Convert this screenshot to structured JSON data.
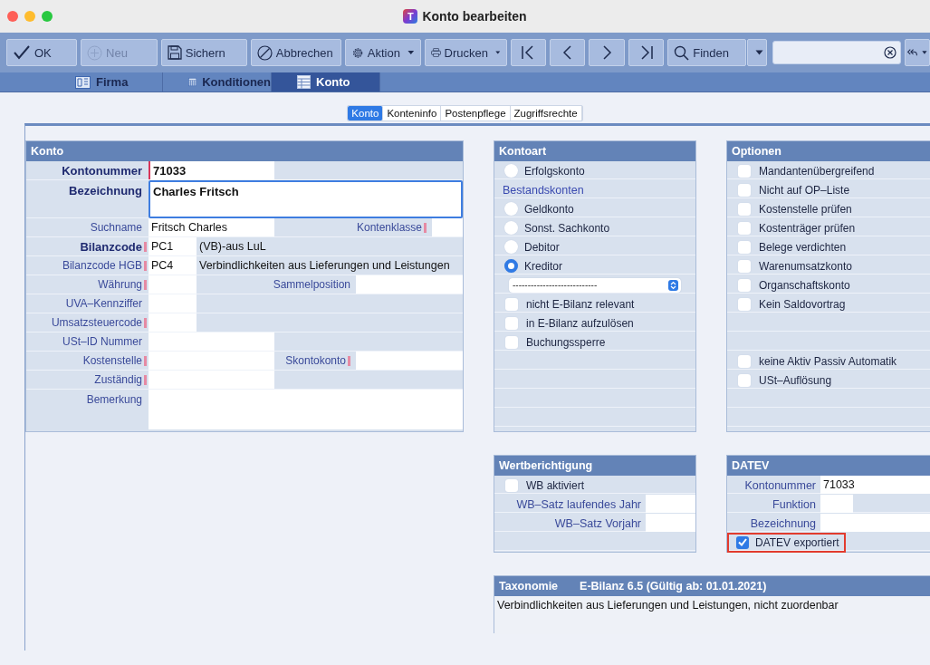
{
  "window": {
    "title": "Konto bearbeiten",
    "logo_text": "T"
  },
  "toolbar": {
    "buttons": [
      {
        "kind": "ok",
        "label": "OK",
        "disabled": false,
        "dropdown": false
      },
      {
        "kind": "new",
        "label": "Neu",
        "disabled": true,
        "dropdown": false
      },
      {
        "kind": "save",
        "label": "Sichern",
        "disabled": false,
        "dropdown": false
      },
      {
        "kind": "cancel",
        "label": "Abbrechen",
        "disabled": false,
        "dropdown": false
      },
      {
        "kind": "action",
        "label": "Aktion",
        "disabled": false,
        "dropdown": true
      },
      {
        "kind": "print",
        "label": "Drucken",
        "disabled": false,
        "dropdown": true
      },
      {
        "kind": "first",
        "disabled": false,
        "dropdown": false
      },
      {
        "kind": "previous",
        "disabled": false,
        "dropdown": false
      },
      {
        "kind": "next",
        "disabled": false,
        "dropdown": false
      },
      {
        "kind": "last",
        "disabled": false,
        "dropdown": false
      },
      {
        "kind": "find",
        "label": "Finden",
        "disabled": false,
        "dropdown": true
      }
    ]
  },
  "tabs": [
    {
      "label": "Firma",
      "selected": false
    },
    {
      "label": "Konditionen",
      "selected": false
    },
    {
      "label": "Konto",
      "selected": true
    }
  ],
  "subtabs": [
    {
      "label": "Konto",
      "selected": true
    },
    {
      "label": "Konteninfo",
      "selected": false
    },
    {
      "label": "Postenpflege",
      "selected": false
    },
    {
      "label": "Zugriffsrechte",
      "selected": false
    }
  ],
  "konto_panel": {
    "title": "Konto",
    "rows": [
      {
        "kind": "number",
        "label": "Kontonummer",
        "bold": true,
        "marked": false,
        "value": "71033"
      },
      {
        "kind": "name",
        "label": "Bezeichnung",
        "bold": true,
        "marked": false,
        "value": "Charles Fritsch"
      },
      {
        "kind": "pair-narrow",
        "label": "Suchname",
        "bold": false,
        "marked": false,
        "value": "Fritsch Charles",
        "label_2": "Kontenklasse",
        "marked_2": true
      },
      {
        "kind": "code",
        "label": "Bilanzcode",
        "bold": true,
        "marked": true,
        "code": "PC1",
        "description": "(VB)-aus LuL"
      },
      {
        "kind": "code",
        "label": "Bilanzcode HGB",
        "bold": false,
        "marked": true,
        "code": "PC4",
        "description": "Verbindlichkeiten aus Lieferungen und Leistungen"
      },
      {
        "kind": "short-pair",
        "label": "Währung",
        "bold": false,
        "marked": true,
        "label_2": "Sammelposition",
        "marked_2": false
      },
      {
        "kind": "short",
        "label": "UVA–Kennziffer",
        "bold": false,
        "marked": false
      },
      {
        "kind": "short",
        "label": "Umsatzsteuercode",
        "bold": false,
        "marked": true
      },
      {
        "kind": "wide",
        "label": "USt–ID Nummer",
        "bold": false,
        "marked": false
      },
      {
        "kind": "pair",
        "label": "Kostenstelle",
        "bold": false,
        "marked": true,
        "label_2": "Skontokonto",
        "marked_2": true
      },
      {
        "kind": "wide",
        "label": "Zuständig",
        "bold": false,
        "marked": true
      },
      {
        "kind": "note",
        "label": "Bemerkung",
        "bold": false,
        "marked": false
      }
    ]
  },
  "kontoart_panel": {
    "title": "Kontoart",
    "items": [
      {
        "kind": "radio",
        "label": "Erfolgskonto",
        "selected": false
      },
      {
        "kind": "heading",
        "label": "Bestandskonten"
      },
      {
        "kind": "radio",
        "label": "Geldkonto",
        "selected": false
      },
      {
        "kind": "radio",
        "label": "Sonst. Sachkonto",
        "selected": false
      },
      {
        "kind": "radio",
        "label": "Debitor",
        "selected": false
      },
      {
        "kind": "radio",
        "label": "Kreditor",
        "selected": true
      },
      {
        "kind": "select",
        "value": "----------------------------"
      },
      {
        "kind": "checkbox",
        "label": "nicht E-Bilanz relevant",
        "checked": false
      },
      {
        "kind": "checkbox",
        "label": "in E-Bilanz aufzulösen",
        "checked": false
      },
      {
        "kind": "checkbox",
        "label": "Buchungssperre",
        "checked": false
      }
    ]
  },
  "optionen_panel": {
    "title": "Optionen",
    "items": [
      {
        "kind": "checkbox",
        "label": "Mandantenübergreifend",
        "checked": false
      },
      {
        "kind": "checkbox",
        "label": "Nicht auf OP–Liste",
        "checked": false
      },
      {
        "kind": "checkbox",
        "label": "Kostenstelle prüfen",
        "checked": false
      },
      {
        "kind": "checkbox",
        "label": "Kostenträger prüfen",
        "checked": false
      },
      {
        "kind": "checkbox",
        "label": "Belege verdichten",
        "checked": false
      },
      {
        "kind": "checkbox",
        "label": "Warenumsatzkonto",
        "checked": false
      },
      {
        "kind": "checkbox",
        "label": "Organschaftskonto",
        "checked": false
      },
      {
        "kind": "checkbox",
        "label": "Kein Saldovortrag",
        "checked": false
      },
      {
        "kind": "spacer"
      },
      {
        "kind": "spacer"
      },
      {
        "kind": "checkbox",
        "label": "keine Aktiv Passiv Automatik",
        "checked": false
      },
      {
        "kind": "checkbox",
        "label": "USt–Auflösung",
        "checked": false
      }
    ]
  },
  "wertberichtigung_panel": {
    "title": "Wertberichtigung",
    "items": [
      {
        "kind": "checkbox",
        "label": "WB aktiviert",
        "checked": false
      },
      {
        "kind": "field",
        "label": "WB–Satz laufendes Jahr"
      },
      {
        "kind": "field",
        "label": "WB–Satz Vorjahr"
      }
    ]
  },
  "datev_panel": {
    "title": "DATEV",
    "items": [
      {
        "kind": "field",
        "label": "Kontonummer",
        "value": "71033"
      },
      {
        "kind": "short-field",
        "label": "Funktion"
      },
      {
        "kind": "field",
        "label": "Bezeichnung"
      },
      {
        "kind": "checkbox",
        "label": "DATEV exportiert",
        "checked": true,
        "highlighted": true
      }
    ]
  },
  "taxonomie_panel": {
    "title": "Taxonomie",
    "subtitle": "E-Bilanz 6.5 (Gültig ab: 01.01.2021)",
    "text": "Verbindlichkeiten aus Lieferungen und Leistungen, nicht zuordenbar"
  }
}
